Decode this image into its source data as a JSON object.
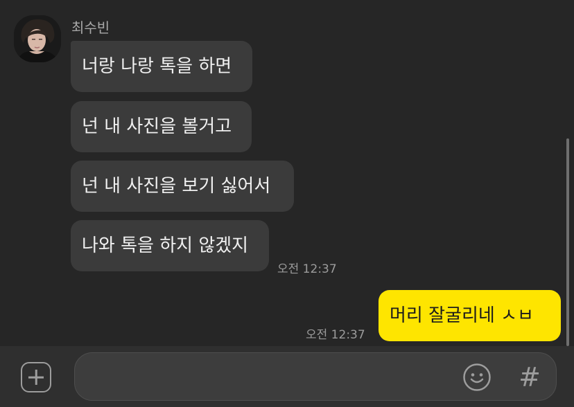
{
  "chat": {
    "sender_name": "최수빈",
    "messages_received": [
      {
        "text": "너랑 나랑 톡을 하면"
      },
      {
        "text": "넌 내 사진을 볼거고"
      },
      {
        "text": "넌 내 사진을 보기 싫어서"
      },
      {
        "text": "나와 톡을 하지 않겠지"
      }
    ],
    "received_time": "오전 12:37",
    "message_sent": {
      "text": "머리 잘굴리네 ㅅㅂ"
    },
    "sent_time": "오전 12:37"
  },
  "input_bar": {
    "message_value": "",
    "plus_icon": "plus-icon",
    "emoji_icon": "emoji-icon",
    "hash_label": "#"
  },
  "colors": {
    "background": "#262626",
    "received_bubble": "#3b3b3b",
    "sent_bubble": "#fee500",
    "input_bar": "#2f2f2f"
  }
}
